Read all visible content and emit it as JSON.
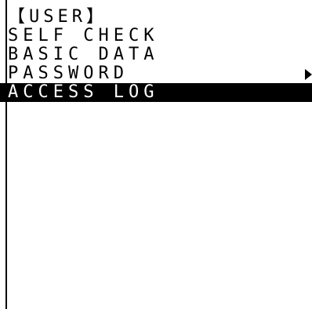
{
  "screen": {
    "title": "【USER】",
    "menu_items": [
      {
        "label": "SELF CHECK"
      },
      {
        "label": "BASIC DATA"
      },
      {
        "label": "PASSWORD"
      },
      {
        "label": "ACCESS LOG"
      }
    ],
    "selected_item": "ACCESS LOG",
    "more_indicator_icon": "right-triangle-icon"
  }
}
